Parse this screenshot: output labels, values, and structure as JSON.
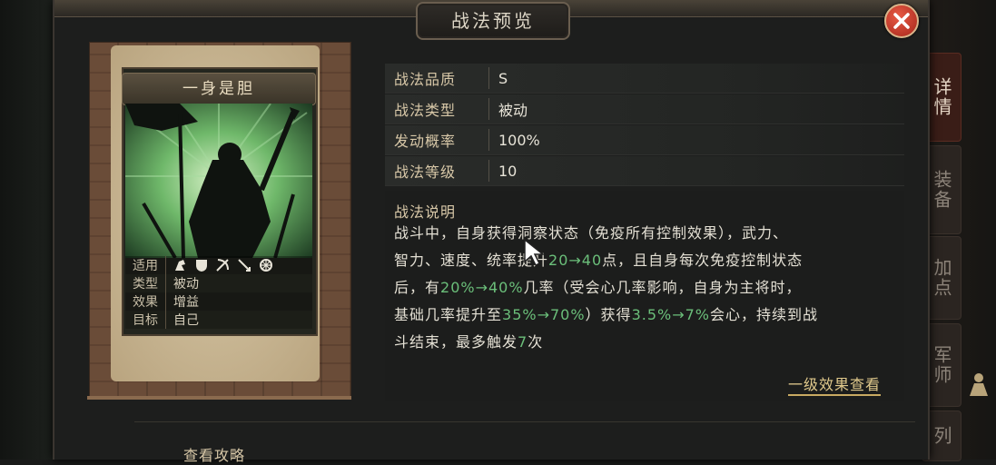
{
  "window": {
    "title": "战法预览"
  },
  "side_tabs": [
    {
      "label": "详情",
      "active": true
    },
    {
      "label": "装备",
      "active": false
    },
    {
      "label": "加点",
      "active": false
    },
    {
      "label": "军师",
      "active": false
    },
    {
      "label": "列",
      "active": false
    }
  ],
  "card": {
    "name": "一身是胆",
    "attributes": [
      {
        "key": "适用",
        "value": "",
        "icons": [
          "cavalry-icon",
          "shield-icon",
          "bow-icon",
          "spear-icon",
          "wheel-icon"
        ]
      },
      {
        "key": "类型",
        "value": "被动"
      },
      {
        "key": "效果",
        "value": "增益"
      },
      {
        "key": "目标",
        "value": "自己"
      }
    ]
  },
  "info": {
    "rows": [
      {
        "key": "战法品质",
        "value": "S"
      },
      {
        "key": "战法类型",
        "value": "被动"
      },
      {
        "key": "发动概率",
        "value": "100%"
      },
      {
        "key": "战法等级",
        "value": "10"
      }
    ],
    "description_title": "战法说明",
    "description": {
      "p1": "战斗中，自身获得洞察状态（免疫所有控制效果），武力、",
      "p2a": "智力、速度、统率提升",
      "p2b": "20→40",
      "p2c": "点，且自身每次免疫控制状态",
      "p3a": "后，有",
      "p3b": "20%→40%",
      "p3c": "几率（受会心几率影响，自身为主将时，",
      "p4a": "基础几率提升至",
      "p4b": "35%→70%",
      "p4c": "）获得",
      "p4d": "3.5%→7%",
      "p4e": "会心，持续到战",
      "p5a": "斗结束，最多触发",
      "p5b": "7",
      "p5c": "次"
    },
    "level_link": "一级效果查看"
  },
  "footer": {
    "guide_link": "查看攻略"
  },
  "colors": {
    "highlight": "#6bbf7a",
    "accent_gold": "#e0c98c",
    "close_red": "#c23a28"
  }
}
